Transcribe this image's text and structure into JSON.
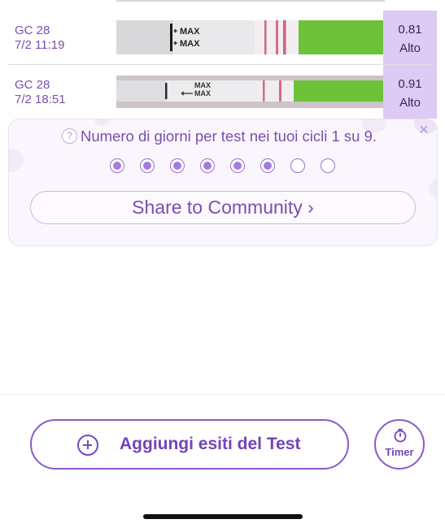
{
  "test_rows": [
    {
      "name": "GC 28",
      "datetime": "7/2 11:19",
      "strip_text": "MAX",
      "value": "0.81",
      "level": "Alto"
    },
    {
      "name": "GC 28",
      "datetime": "7/2 18:51",
      "strip_text": "MAX",
      "value": "0.91",
      "level": "Alto"
    }
  ],
  "card": {
    "help_icon": "?",
    "close_icon": "✕",
    "title": "Numero di giorni per test nei tuoi cicli 1 su 9.",
    "progress_dots": {
      "filled": 6,
      "total": 8
    },
    "share_label": "Share to Community",
    "share_chevron": "›"
  },
  "actions": {
    "add_label": "Aggiungi esiti del Test",
    "timer_label": "Timer"
  },
  "colors": {
    "accent": "#7a4fae",
    "result_bg": "#dccbf4",
    "strip_green": "#6cc33a"
  }
}
